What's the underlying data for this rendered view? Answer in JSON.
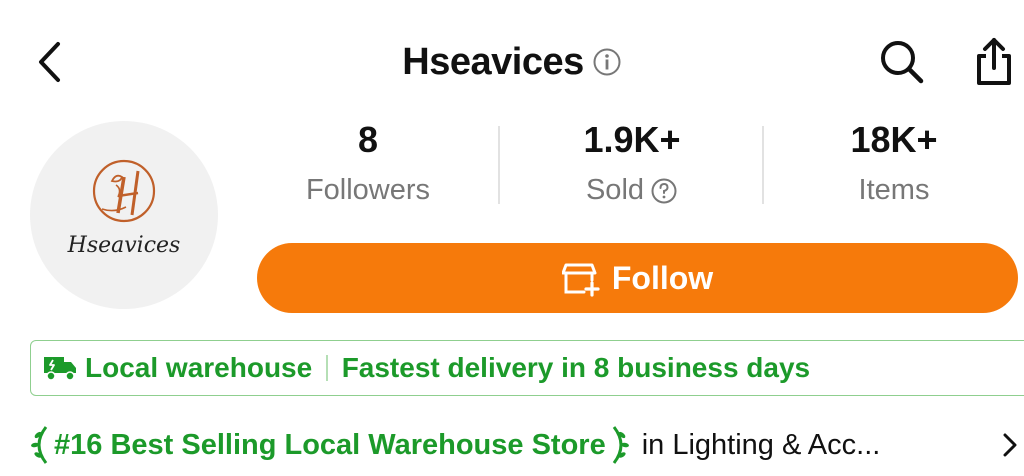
{
  "header": {
    "title": "Hseavices",
    "icons": {
      "back": "back-arrow-icon",
      "info": "info-icon",
      "search": "search-icon",
      "share": "share-icon"
    }
  },
  "store": {
    "avatar_text": "Hseavices"
  },
  "stats": [
    {
      "value": "8",
      "label": "Followers"
    },
    {
      "value": "1.9K+",
      "label": "Sold"
    },
    {
      "value": "18K+",
      "label": "Items"
    }
  ],
  "follow_button": {
    "label": "Follow",
    "color": "#f67a0b"
  },
  "banner": {
    "warehouse": "Local warehouse",
    "delivery": "Fastest delivery in 8 business days",
    "color": "#1c9a2a"
  },
  "ranking": {
    "title": "#16 Best Selling Local Warehouse Store",
    "category": "in Lighting & Acc..."
  }
}
